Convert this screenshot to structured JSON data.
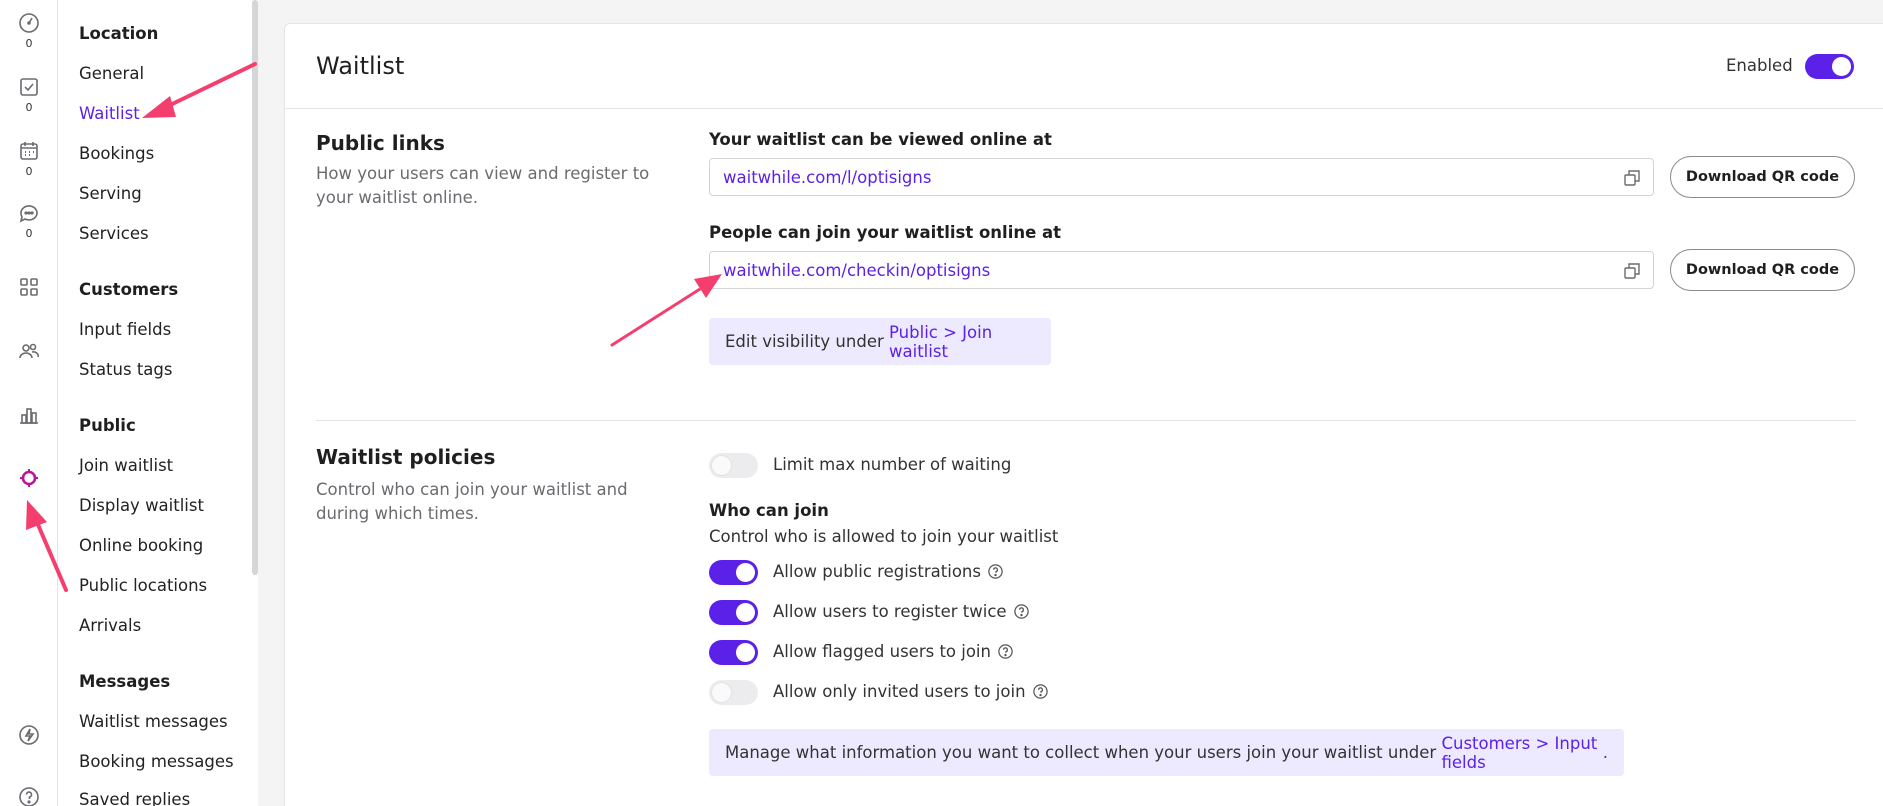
{
  "rail": {
    "items": [
      {
        "icon": "gauge-icon",
        "count": "0"
      },
      {
        "icon": "checkbox-icon",
        "count": "0"
      },
      {
        "icon": "calendar-icon",
        "count": "0"
      },
      {
        "icon": "chat-icon",
        "count": "0"
      },
      {
        "icon": "apps-icon"
      },
      {
        "icon": "users-icon"
      },
      {
        "icon": "analytics-icon"
      },
      {
        "icon": "settings-icon"
      },
      {
        "icon": "bolt-icon"
      },
      {
        "icon": "help-icon"
      }
    ]
  },
  "nav": {
    "sections": [
      {
        "title": "Location",
        "items": [
          "General",
          "Waitlist",
          "Bookings",
          "Serving",
          "Services"
        ]
      },
      {
        "title": "Customers",
        "items": [
          "Input fields",
          "Status tags"
        ]
      },
      {
        "title": "Public",
        "items": [
          "Join waitlist",
          "Display waitlist",
          "Online booking",
          "Public locations",
          "Arrivals"
        ]
      },
      {
        "title": "Messages",
        "items": [
          "Waitlist messages",
          "Booking messages",
          "Saved replies"
        ]
      }
    ],
    "active": "Waitlist"
  },
  "header": {
    "title": "Waitlist",
    "enabled_label": "Enabled",
    "enabled": true
  },
  "public_links": {
    "title": "Public links",
    "description": "How your users can view and register to your waitlist online.",
    "view_label": "Your waitlist can be viewed online at",
    "view_url": "waitwhile.com/l/optisigns",
    "join_label": "People can join your waitlist online at",
    "join_url": "waitwhile.com/checkin/optisigns",
    "qr_button": "Download QR code",
    "visibility_text": "Edit visibility under ",
    "visibility_link": "Public > Join waitlist"
  },
  "policies": {
    "title": "Waitlist policies",
    "description": "Control who can join your waitlist and during which times.",
    "limit_label": "Limit max number of waiting",
    "limit_enabled": false,
    "who_title": "Who can join",
    "who_desc": "Control who is allowed to join your waitlist",
    "options": [
      {
        "label": "Allow public registrations",
        "enabled": true
      },
      {
        "label": "Allow users to register twice",
        "enabled": true
      },
      {
        "label": "Allow flagged users to join",
        "enabled": true
      },
      {
        "label": "Allow only invited users to join",
        "enabled": false
      }
    ],
    "collect_text": "Manage what information you want to collect when your users join your waitlist under ",
    "collect_link": "Customers > Input fields",
    "collect_suffix": "."
  },
  "colors": {
    "accent": "#5b21e8",
    "arrow": "#f43f6e",
    "info_bg": "#ede9fe"
  }
}
